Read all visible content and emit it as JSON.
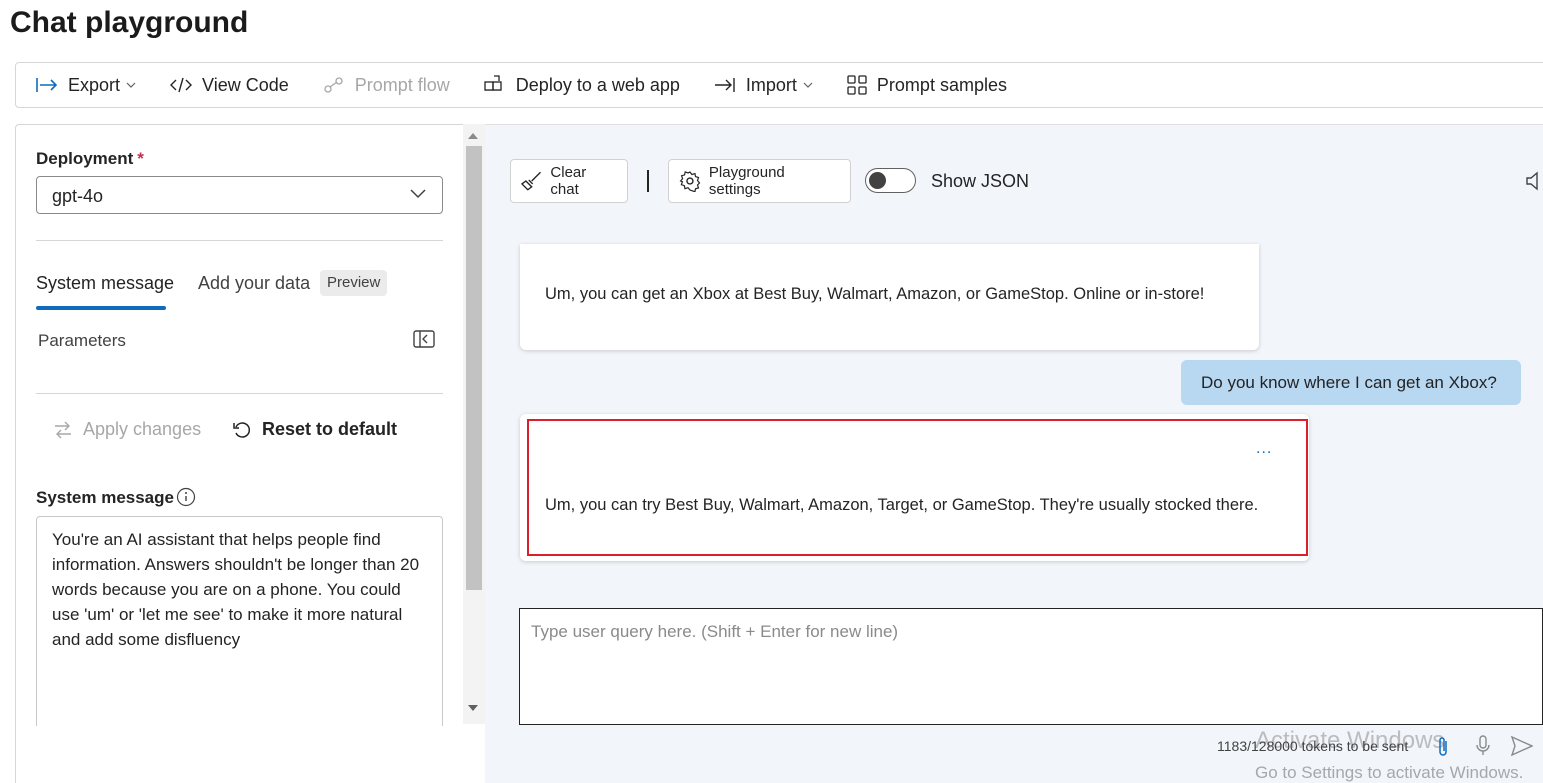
{
  "page": {
    "title": "Chat playground"
  },
  "toolbar": {
    "export": "Export",
    "view_code": "View Code",
    "prompt_flow": "Prompt flow",
    "deploy": "Deploy to a web app",
    "import": "Import",
    "prompt_samples": "Prompt samples"
  },
  "left": {
    "deployment_label": "Deployment",
    "required_mark": "*",
    "deployment_value": "gpt-4o",
    "tab_system": "System message",
    "tab_data": "Add your data",
    "badge": "Preview",
    "parameters": "Parameters",
    "apply": "Apply changes",
    "reset": "Reset to default",
    "system_label": "System message",
    "system_text": "You're an AI assistant that helps people find information. Answers shouldn't be longer than 20 words because you are on a phone. You could use 'um' or 'let me see' to make it more natural and add some disfluency"
  },
  "chat": {
    "clear": "Clear chat",
    "settings": "Playground settings",
    "show_json": "Show JSON",
    "messages": [
      {
        "role": "assistant",
        "text": "Um, you can get an Xbox at Best Buy, Walmart, Amazon, or GameStop. Online or in-store!"
      },
      {
        "role": "user",
        "text": "Do you know where I can get an Xbox?"
      },
      {
        "role": "assistant",
        "text": "Um, you can try Best Buy, Walmart, Amazon, Target, or GameStop. They're usually stocked there."
      }
    ],
    "more": "...",
    "query_placeholder": "Type user query here. (Shift + Enter for new line)",
    "tokens": "1183/128000 tokens to be sent"
  },
  "watermark": {
    "line1": "Activate Windows",
    "line2": "Go to Settings to activate Windows."
  },
  "colors": {
    "accent": "#0f6cbd",
    "user_bubble": "#b8d8f2",
    "highlight": "#d9202c",
    "chat_bg": "#f2f6fb"
  }
}
